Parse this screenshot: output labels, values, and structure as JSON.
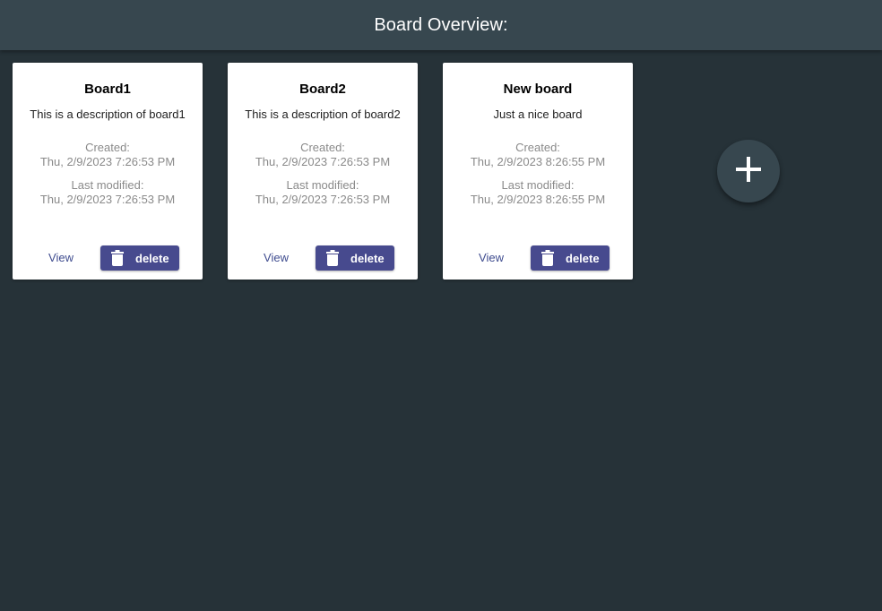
{
  "header": {
    "title": "Board Overview:"
  },
  "boards": [
    {
      "title": "Board1",
      "description": "This is a description of board1",
      "created_label": "Created:",
      "created": "Thu, 2/9/2023 7:26:53 PM",
      "modified_label": "Last modified:",
      "modified": "Thu, 2/9/2023 7:26:53 PM",
      "view_label": "View",
      "delete_label": "delete"
    },
    {
      "title": "Board2",
      "description": "This is a description of board2",
      "created_label": "Created:",
      "created": "Thu, 2/9/2023 7:26:53 PM",
      "modified_label": "Last modified:",
      "modified": "Thu, 2/9/2023 7:26:53 PM",
      "view_label": "View",
      "delete_label": "delete"
    },
    {
      "title": "New board",
      "description": "Just a nice board",
      "created_label": "Created:",
      "created": "Thu, 2/9/2023 8:26:55 PM",
      "modified_label": "Last modified:",
      "modified": "Thu, 2/9/2023 8:26:55 PM",
      "view_label": "View",
      "delete_label": "delete"
    }
  ],
  "icons": {
    "delete": "trash-icon",
    "add": "plus-icon"
  },
  "colors": {
    "background": "#263238",
    "header": "#37474f",
    "primary": "#474a8e",
    "link": "#3f4c8f",
    "fab": "#37474f"
  }
}
